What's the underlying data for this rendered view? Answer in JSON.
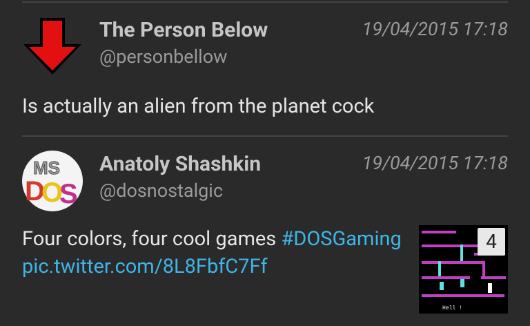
{
  "tweets": [
    {
      "name": "The Person Below",
      "handle": "@personbellow",
      "time": "19/04/2015 17:18",
      "text": "Is actually an alien from the planet cock",
      "avatar": "red-down-arrow-icon"
    },
    {
      "name": "Anatoly Shashkin",
      "handle": "@dosnostalgic",
      "time": "19/04/2015 17:18",
      "text": "Four colors, four cool games ",
      "hashtag": "#DOSGaming",
      "link": "pic.twitter.com/8L8FbfC7Ff",
      "avatar": "ms-dos-logo",
      "media": {
        "count": "4",
        "caption": "Hell !"
      }
    }
  ],
  "colors": {
    "background": "#2a2a2a",
    "link": "#3fb5e8",
    "arrow": "#e21010"
  }
}
